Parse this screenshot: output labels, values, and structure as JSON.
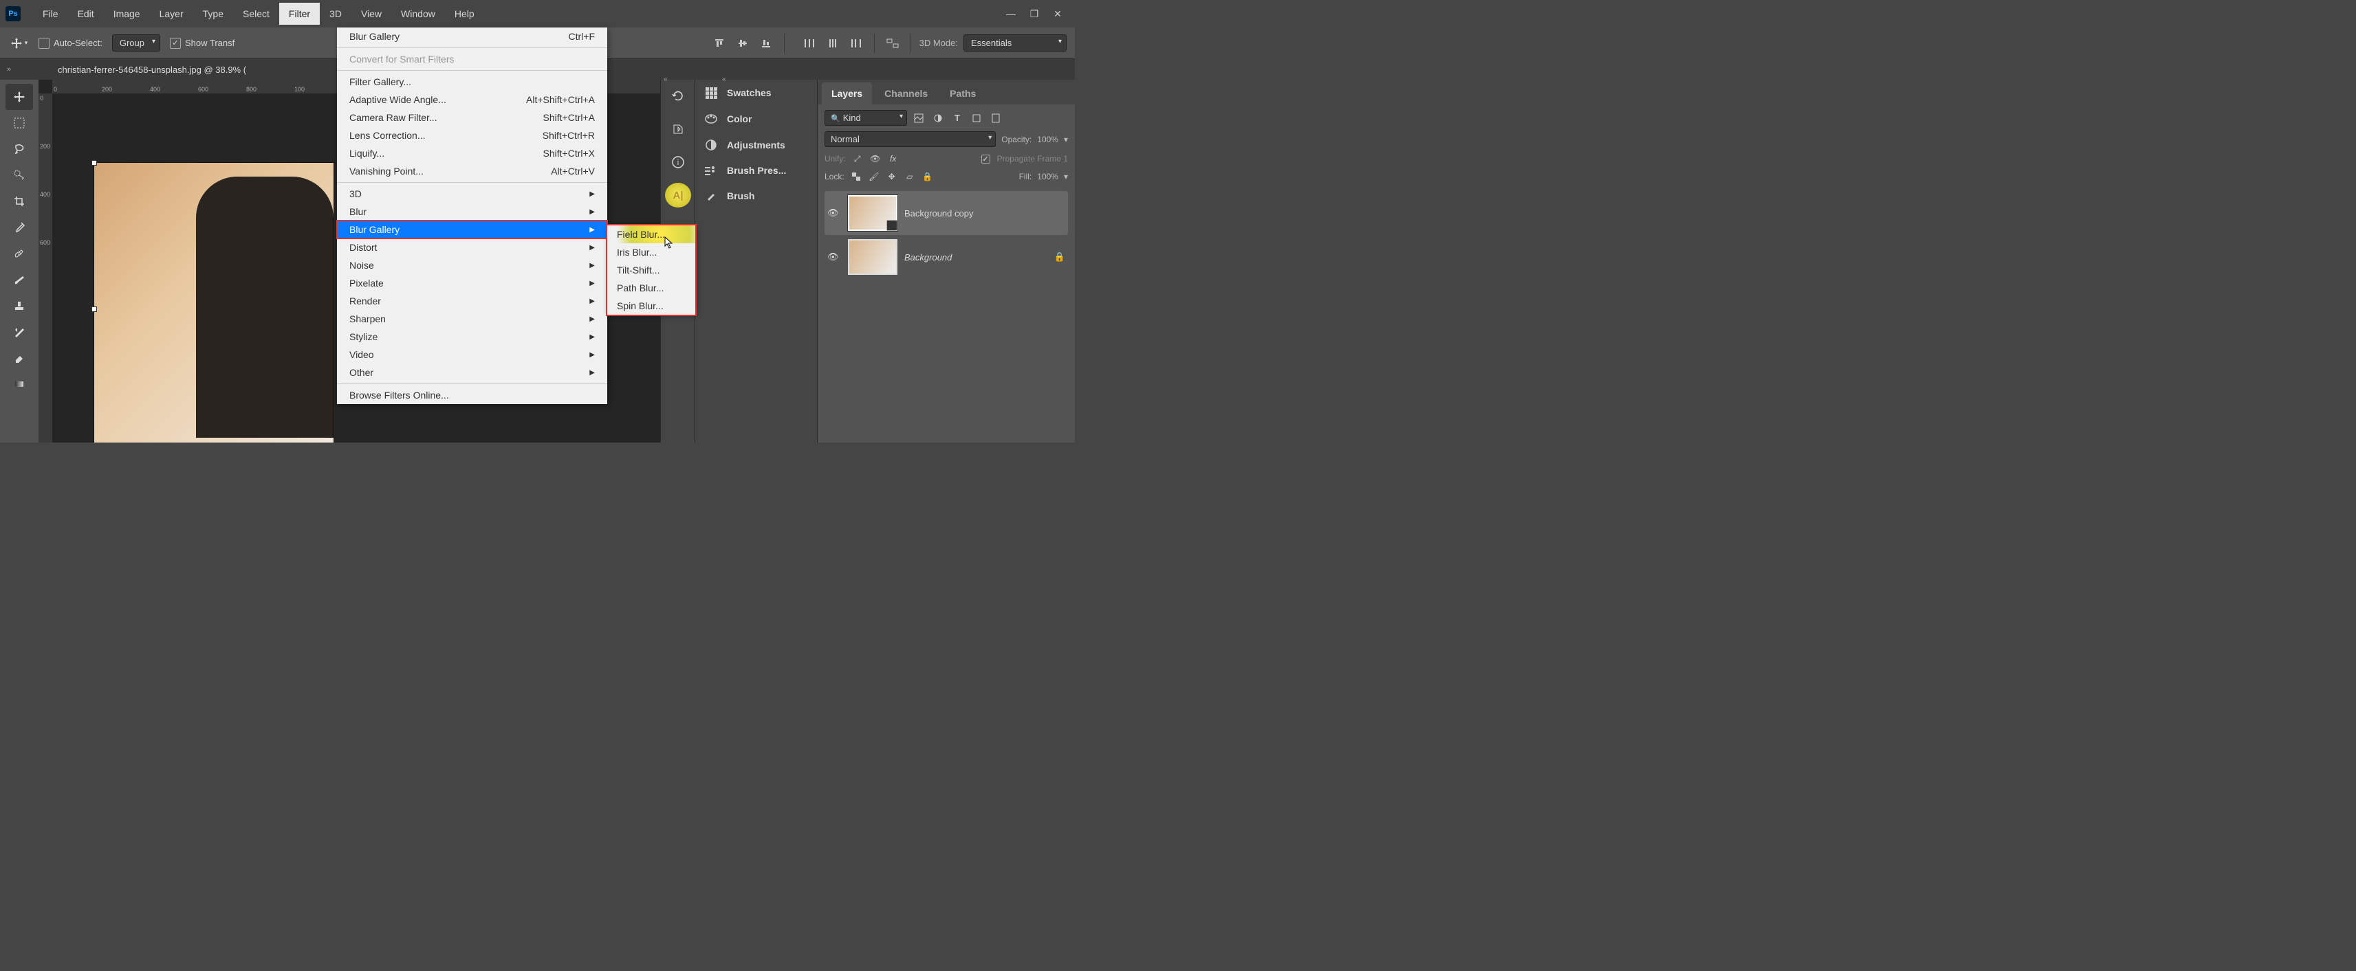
{
  "app": {
    "name": "Ps"
  },
  "menuBar": {
    "items": [
      "File",
      "Edit",
      "Image",
      "Layer",
      "Type",
      "Select",
      "Filter",
      "3D",
      "View",
      "Window",
      "Help"
    ],
    "openIndex": 6
  },
  "windowControls": {
    "min": "—",
    "max": "❐",
    "close": "✕"
  },
  "optionsBar": {
    "autoSelectLabel": "Auto-Select:",
    "autoSelectValue": "Group",
    "showTransform": "Show Transf",
    "mode3dLabel": "3D Mode:",
    "workspace": "Essentials"
  },
  "document": {
    "tabTitle": "christian-ferrer-546458-unsplash.jpg @ 38.9% ("
  },
  "ruler": {
    "h": [
      "0",
      "200",
      "400",
      "600",
      "800",
      "100"
    ],
    "v": [
      "0",
      "200",
      "400",
      "600"
    ]
  },
  "filterMenu": {
    "lastFilter": {
      "label": "Blur Gallery",
      "shortcut": "Ctrl+F"
    },
    "convertSmart": "Convert for Smart Filters",
    "filterGallery": "Filter Gallery...",
    "adaptiveWide": {
      "label": "Adaptive Wide Angle...",
      "shortcut": "Alt+Shift+Ctrl+A"
    },
    "cameraRaw": {
      "label": "Camera Raw Filter...",
      "shortcut": "Shift+Ctrl+A"
    },
    "lensCorrection": {
      "label": "Lens Correction...",
      "shortcut": "Shift+Ctrl+R"
    },
    "liquify": {
      "label": "Liquify...",
      "shortcut": "Shift+Ctrl+X"
    },
    "vanishing": {
      "label": "Vanishing Point...",
      "shortcut": "Alt+Ctrl+V"
    },
    "categories": [
      "3D",
      "Blur",
      "Blur Gallery",
      "Distort",
      "Noise",
      "Pixelate",
      "Render",
      "Sharpen",
      "Stylize",
      "Video",
      "Other"
    ],
    "browse": "Browse Filters Online...",
    "highlightedIndex": 2
  },
  "blurGallerySubmenu": {
    "items": [
      "Field Blur...",
      "Iris Blur...",
      "Tilt-Shift...",
      "Path Blur...",
      "Spin Blur..."
    ],
    "highlightedIndex": 0
  },
  "sidePanels": {
    "swatches": "Swatches",
    "color": "Color",
    "adjustments": "Adjustments",
    "brushPresets": "Brush Pres...",
    "brush": "Brush"
  },
  "layersPanel": {
    "tabs": [
      "Layers",
      "Channels",
      "Paths"
    ],
    "activeTab": 0,
    "kindLabel": "Kind",
    "blendMode": "Normal",
    "opacityLabel": "Opacity:",
    "opacityValue": "100%",
    "unifyLabel": "Unify:",
    "propagate": "Propagate Frame 1",
    "lockLabel": "Lock:",
    "fillLabel": "Fill:",
    "fillValue": "100%",
    "layers": [
      {
        "name": "Background copy",
        "visible": true,
        "selected": true,
        "smart": true,
        "italic": false,
        "locked": false
      },
      {
        "name": "Background",
        "visible": true,
        "selected": false,
        "smart": false,
        "italic": true,
        "locked": true
      }
    ]
  }
}
